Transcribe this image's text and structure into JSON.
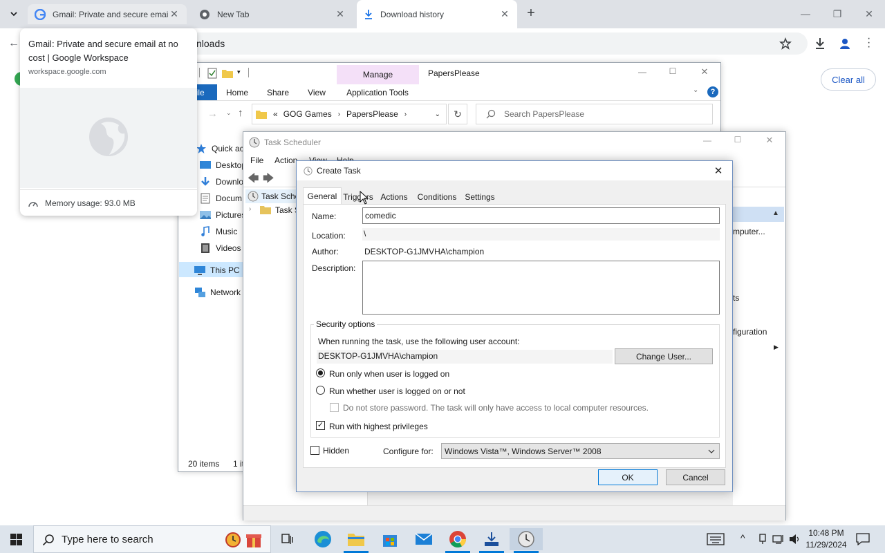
{
  "chrome": {
    "tabs": [
      {
        "title": "Gmail: Private and secure email at no cost | Google Workspace",
        "short": "Gmail: Private and secure email"
      },
      {
        "title": "New Tab"
      },
      {
        "title": "Download history"
      }
    ],
    "omnibox_text": "nloads",
    "clear_all_label": "Clear all",
    "hovercard": {
      "title": "Gmail: Private and secure email at no cost | Google Workspace",
      "domain": "workspace.google.com",
      "memory": "Memory usage: 93.0 MB"
    }
  },
  "explorer": {
    "context_tab": "Manage",
    "window_title": "PapersPlease",
    "ribbon_tabs": [
      "File",
      "Home",
      "Share",
      "View",
      "Application Tools"
    ],
    "breadcrumb": [
      "«",
      "GOG Games",
      "PapersPlease"
    ],
    "search_placeholder": "Search PapersPlease",
    "nav": {
      "quick_access": "Quick acc",
      "desktop": "Desktop",
      "downloads": "Downlo",
      "documents": "Docum",
      "pictures": "Pictures",
      "music": "Music",
      "videos": "Videos",
      "this_pc": "This PC",
      "network": "Network"
    },
    "status_items": "20 items",
    "status_sel": "1 it"
  },
  "tasksched": {
    "title": "Task Scheduler",
    "menu": [
      "File",
      "Action",
      "View",
      "Help"
    ],
    "tree": [
      "Task Sche",
      "Task S"
    ],
    "actions_frag": [
      "mputer...",
      "ts",
      "figuration"
    ]
  },
  "dialog": {
    "title": "Create Task",
    "tabs": [
      "General",
      "Triggers",
      "Actions",
      "Conditions",
      "Settings"
    ],
    "name_label": "Name:",
    "name_value": "comedic",
    "location_label": "Location:",
    "location_value": "\\",
    "author_label": "Author:",
    "author_value": "DESKTOP-G1JMVHA\\champion",
    "description_label": "Description:",
    "security_group": "Security options",
    "security_prompt": "When running the task, use the following user account:",
    "account_value": "DESKTOP-G1JMVHA\\champion",
    "change_user_label": "Change User...",
    "radio_logged_on": "Run only when user is logged on",
    "radio_whether": "Run whether user is logged on or not",
    "no_store_pw": "Do not store password.  The task will only have access to local computer resources.",
    "highest_priv": "Run with highest privileges",
    "hidden_label": "Hidden",
    "configure_label": "Configure for:",
    "configure_value": "Windows Vista™, Windows Server™ 2008",
    "ok_label": "OK",
    "cancel_label": "Cancel",
    "state": {
      "run_logged_on": true,
      "highest_privileges": true,
      "hidden": false,
      "no_store_password": false
    }
  },
  "taskbar": {
    "search_placeholder": "Type here to search",
    "time": "10:48 PM",
    "date": "11/29/2024"
  }
}
